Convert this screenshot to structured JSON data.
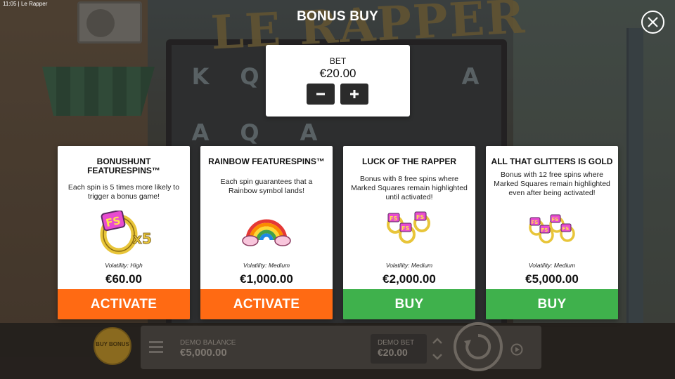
{
  "app": {
    "clock": "11:05 | Le Rapper",
    "logo_text": "LE RAPPER"
  },
  "overlay": {
    "title": "BONUS BUY"
  },
  "bet": {
    "label": "BET",
    "value": "€20.00"
  },
  "background_reels": [
    "K",
    "Q",
    "A",
    "A",
    "Q",
    "A"
  ],
  "cards": [
    {
      "title": "BONUSHUNT FEATURESPINS™",
      "description": "Each spin is 5 times more likely to trigger a bonus game!",
      "icon": "fs-ring-x5-icon",
      "icon_text": "x5",
      "volatility": "Volatility: High",
      "price": "€60.00",
      "button": "ACTIVATE",
      "button_color": "#ff6a13"
    },
    {
      "title": "RAINBOW FEATURESPINS™",
      "description": "Each spin guarantees that a Rainbow symbol lands!",
      "icon": "rainbow-icon",
      "volatility": "Volatility: Medium",
      "price": "€1,000.00",
      "button": "ACTIVATE",
      "button_color": "#ff6a13"
    },
    {
      "title": "LUCK OF THE RAPPER",
      "description": "Bonus with 8 free spins where Marked Squares remain highlighted until activated!",
      "icon": "three-fs-rings-icon",
      "volatility": "Volatility: Medium",
      "price": "€2,000.00",
      "button": "BUY",
      "button_color": "#3fb14c"
    },
    {
      "title": "ALL THAT GLITTERS IS GOLD",
      "description": "Bonus with 12 free spins where Marked Squares remain highlighted even after being activated!",
      "icon": "four-fs-rings-icon",
      "volatility": "Volatility: Medium",
      "price": "€5,000.00",
      "button": "BUY",
      "button_color": "#3fb14c"
    }
  ],
  "bottom_bar": {
    "buy_bonus": "BUY BONUS",
    "demo_balance_label": "DEMO BALANCE",
    "demo_balance_value": "€5,000.00",
    "demo_bet_label": "DEMO BET",
    "demo_bet_value": "€20.00"
  },
  "colors": {
    "activate": "#ff6a13",
    "buy": "#3fb14c",
    "ring_gold": "#e8c53a",
    "fs_pink": "#e84bd0"
  }
}
